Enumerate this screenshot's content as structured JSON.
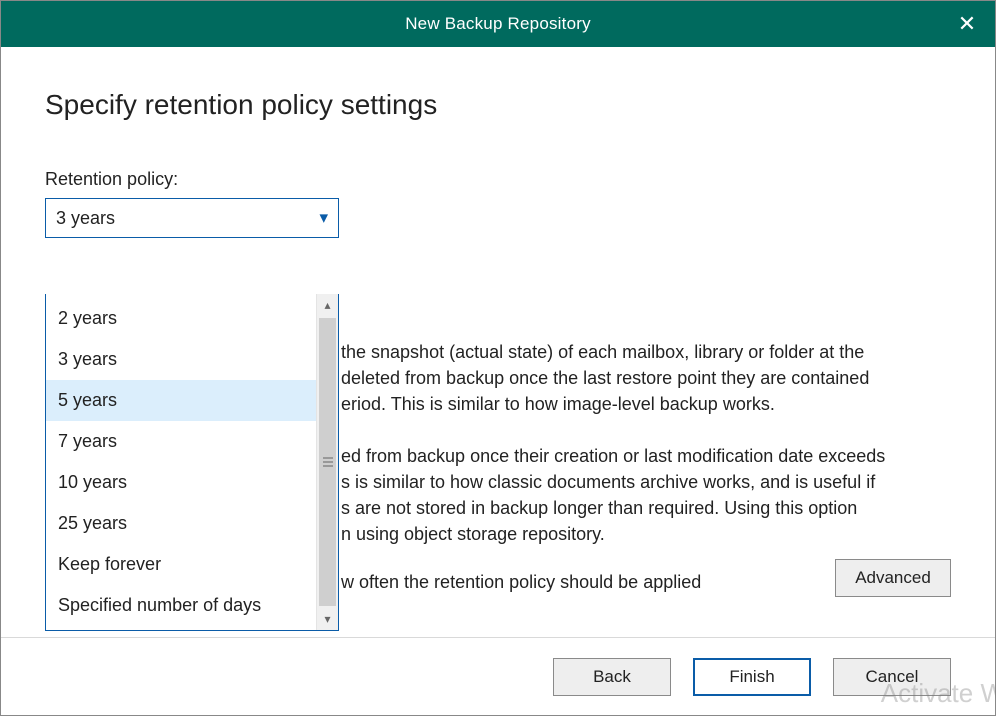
{
  "titlebar": {
    "title": "New Backup Repository",
    "close": "✕"
  },
  "heading": "Specify retention policy settings",
  "retention": {
    "label": "Retention policy:",
    "selected": "3 years",
    "highlighted_index": 2,
    "options": [
      "2 years",
      "3 years",
      "5 years",
      "7 years",
      "10 years",
      "25 years",
      "Keep forever",
      "Specified number of days"
    ]
  },
  "body": {
    "p1_l1": "the snapshot (actual state) of each mailbox, library or folder at the",
    "p1_l2": "deleted from backup once the last restore point they are contained",
    "p1_l3": "eriod. This is similar to how image-level backup works.",
    "p2_l1": "ed from backup once their creation or last modification date exceeds",
    "p2_l2": "s is similar to how classic documents archive works, and is useful if",
    "p2_l3": "s are not stored in backup longer than required. Using this option",
    "p2_l4": "n using object storage repository.",
    "p3": "w often the retention policy should be applied"
  },
  "buttons": {
    "advanced": "Advanced",
    "back": "Back",
    "finish": "Finish",
    "cancel": "Cancel"
  },
  "watermark": "Activate W"
}
